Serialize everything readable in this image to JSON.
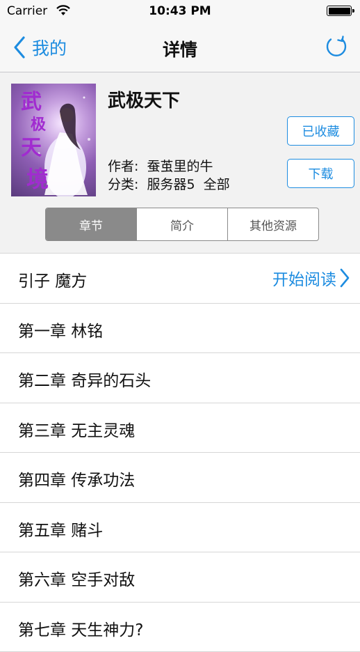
{
  "status_bar": {
    "carrier": "Carrier",
    "time": "10:43 PM"
  },
  "nav": {
    "back_label": "我的",
    "title": "详情"
  },
  "book": {
    "title": "武极天下",
    "author_label": "作者:",
    "author": "蚕茧里的牛",
    "category_label": "分类:",
    "category": "服务器5  全部",
    "cover_text": [
      "武",
      "极",
      "天",
      "境"
    ]
  },
  "buttons": {
    "favorited": "已收藏",
    "download": "下载"
  },
  "tabs": [
    {
      "label": "章节",
      "active": true
    },
    {
      "label": "简介",
      "active": false
    },
    {
      "label": "其他资源",
      "active": false
    }
  ],
  "start_reading": "开始阅读",
  "chapters": [
    "引子 魔方",
    "第一章 林铭",
    "第二章 奇异的石头",
    "第三章 无主灵魂",
    "第四章 传承功法",
    "第五章 赌斗",
    "第六章 空手对敌",
    "第七章 天生神力?"
  ],
  "colors": {
    "accent": "#1d8ce0",
    "segment_active": "#8a8a8a",
    "panel_bg": "#f2f2f2"
  }
}
